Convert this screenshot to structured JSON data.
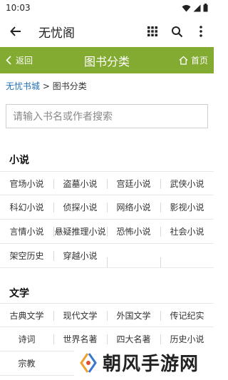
{
  "status": {
    "time": "10:03"
  },
  "app_bar": {
    "title": "无忧阁"
  },
  "header": {
    "back_label": "返回",
    "title": "图书分类",
    "home_label": "首页"
  },
  "breadcrumb": {
    "home": "无忧书城",
    "separator": " > ",
    "current": "图书分类"
  },
  "search": {
    "placeholder": "请输入书名或作者搜索"
  },
  "sections": [
    {
      "title": "小说",
      "rows": [
        [
          "官场小说",
          "盗墓小说",
          "宫廷小说",
          "武侠小说"
        ],
        [
          "科幻小说",
          "侦探小说",
          "网络小说",
          "影视小说"
        ],
        [
          "言情小说",
          "悬疑推理小说",
          "恐怖小说",
          "社会小说"
        ],
        [
          "架空历史",
          "穿越小说",
          "",
          ""
        ]
      ]
    },
    {
      "title": "文学",
      "rows": [
        [
          "古典文学",
          "现代文学",
          "外国文学",
          "传记纪实"
        ],
        [
          "诗词",
          "世界名著",
          "四大名著",
          "历史小说"
        ],
        [
          "宗教",
          "",
          "",
          ""
        ]
      ]
    }
  ],
  "watermark": {
    "text": "朝风手游网"
  }
}
